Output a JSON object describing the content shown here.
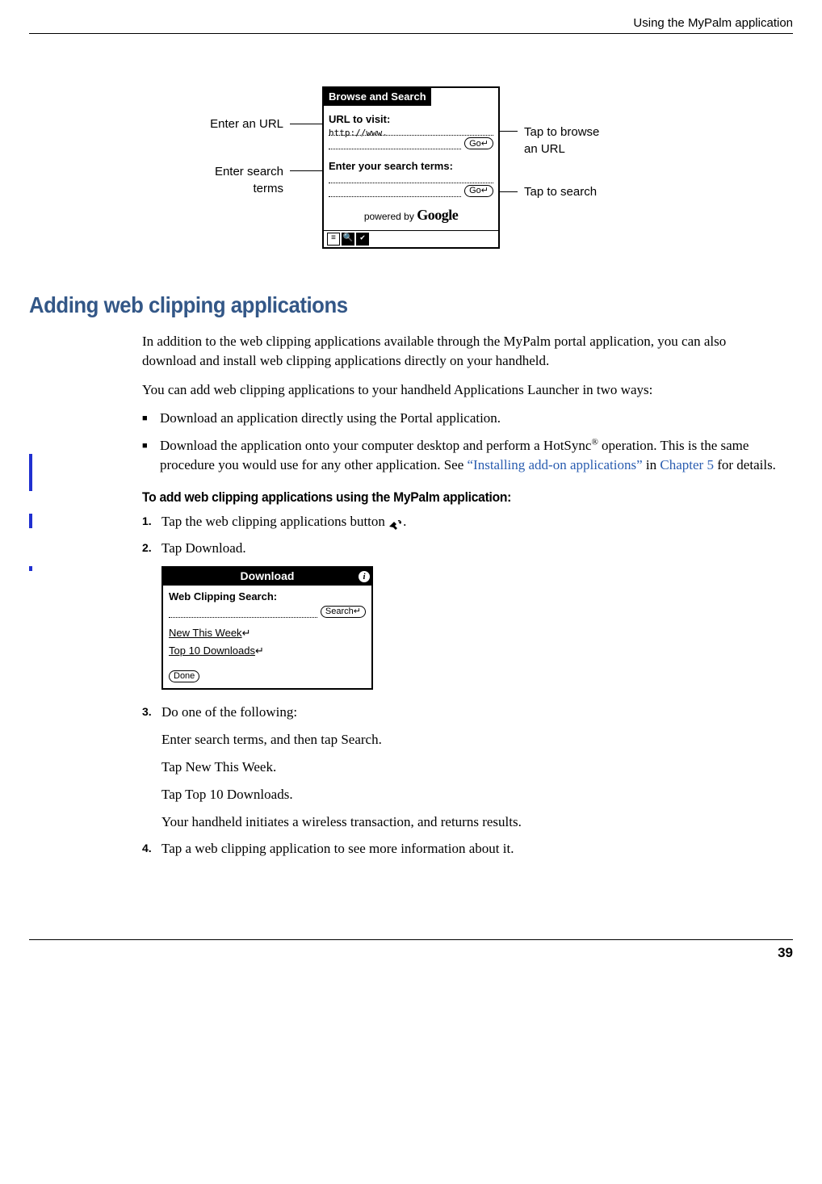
{
  "header": {
    "running_head": "Using the MyPalm application"
  },
  "figure1": {
    "callouts": {
      "enter_url": "Enter an URL",
      "enter_search": "Enter search\nterms",
      "tap_browse": "Tap to browse\nan URL",
      "tap_search": "Tap to search"
    },
    "palm": {
      "title": "Browse and Search",
      "url_label": "URL to visit:",
      "url_value": "http://www.",
      "go": "Go",
      "search_label": "Enter your search terms:",
      "powered_prefix": "powered by ",
      "powered_brand": "Google"
    }
  },
  "section": {
    "heading": "Adding web clipping applications"
  },
  "p1": "In addition to the web clipping applications available through the MyPalm portal application, you can also download and install web clipping applications directly on your handheld.",
  "p2": "You can add web clipping applications to your handheld Applications Launcher in two ways:",
  "bullets": {
    "b1": "Download an application directly using the Portal application.",
    "b2_a": "Download the application onto your computer desktop and perform a HotSync",
    "b2_reg": "®",
    "b2_b": " operation. This is the same procedure you would use for any other application. See ",
    "b2_link1": "“Installing add-on applications”",
    "b2_c": " in ",
    "b2_link2": "Chapter 5",
    "b2_d": " for details."
  },
  "subheading": "To add web clipping applications using the MyPalm application:",
  "steps": {
    "s1_a": "Tap the web clipping applications button ",
    "s1_b": ".",
    "s2": "Tap Download.",
    "s3": "Do one of the following:",
    "s3a": "Enter search terms, and then tap Search.",
    "s3b": "Tap New This Week.",
    "s3c": "Tap Top 10 Downloads.",
    "s3d": "Your handheld initiates a wireless transaction, and returns results.",
    "s4": "Tap a web clipping application to see more information about it."
  },
  "figure2": {
    "title": "Download",
    "label": "Web Clipping Search:",
    "search_btn": "Search",
    "link1": "New This Week",
    "link2": "Top 10 Downloads",
    "done": "Done"
  },
  "footer": {
    "page": "39"
  }
}
